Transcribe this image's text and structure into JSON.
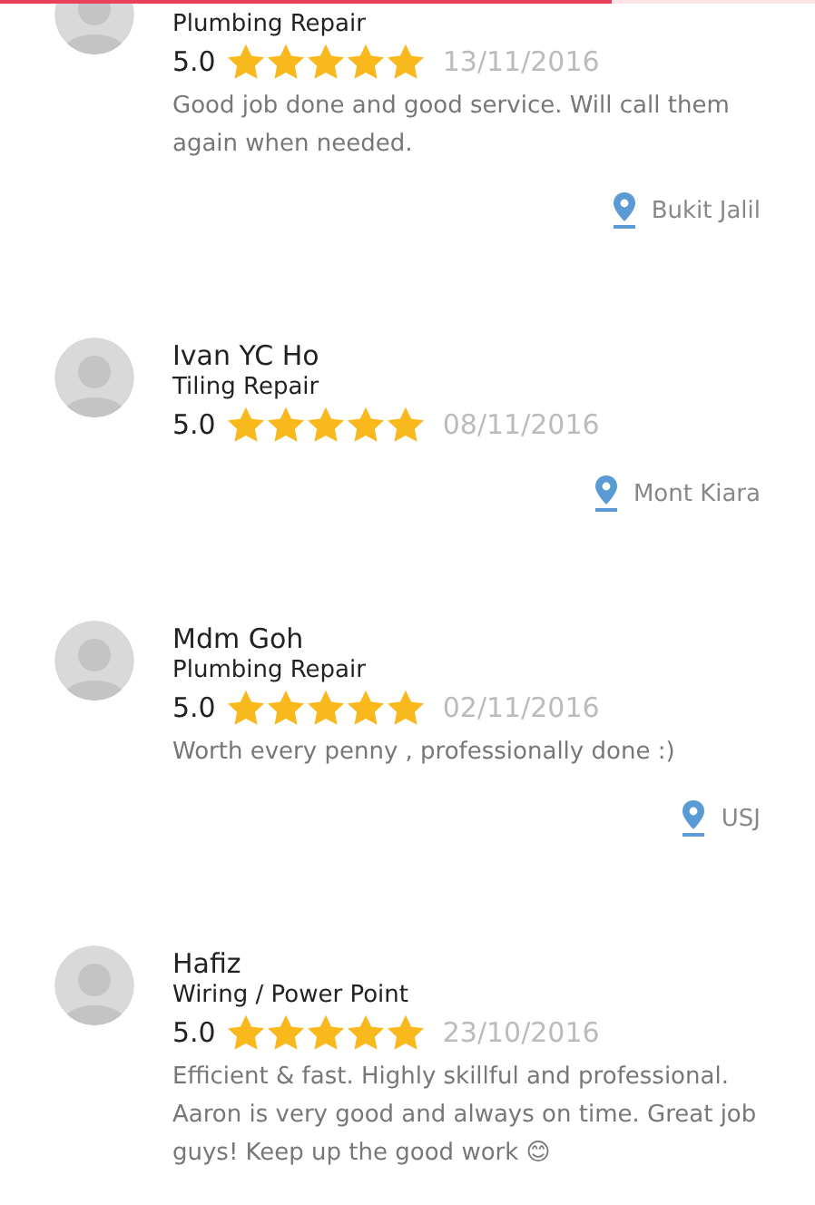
{
  "progress": {
    "level": 0.75
  },
  "reviews": [
    {
      "service": "Plumbing Repair",
      "score": "5.0",
      "stars": 5,
      "date": "13/11/2016",
      "comment": "Good job done and good service. Will call them again when needed.",
      "location": "Bukit Jalil"
    },
    {
      "name": "Ivan YC Ho",
      "service": "Tiling Repair",
      "score": "5.0",
      "stars": 5,
      "date": "08/11/2016",
      "location": "Mont Kiara"
    },
    {
      "name": "Mdm Goh",
      "service": "Plumbing Repair",
      "score": "5.0",
      "stars": 5,
      "date": "02/11/2016",
      "comment": "Worth every penny , professionally done :)",
      "location": "USJ"
    },
    {
      "name": "Hafiz",
      "service": "Wiring / Power Point",
      "score": "5.0",
      "stars": 5,
      "date": "23/10/2016",
      "comment": "Efficient & fast. Highly skillful and professional. Aaron is very good and always on time. Great job guys! Keep up the good work 😊"
    }
  ]
}
